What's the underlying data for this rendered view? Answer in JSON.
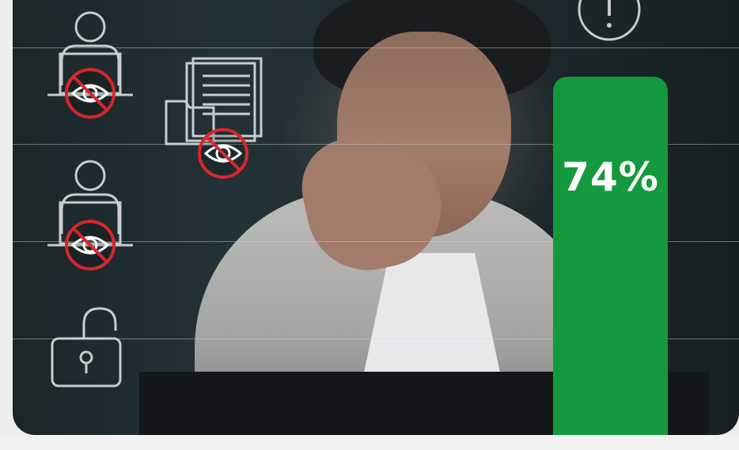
{
  "stat": {
    "value_label": "74%",
    "percent": 74
  },
  "colors": {
    "bar": "#149a3c",
    "forbidden": "#d8262b",
    "icon_stroke": "#c8ccce"
  },
  "icons": [
    "user-laptop-icon",
    "no-eye-icon",
    "folder-document-icon",
    "no-eye-icon",
    "user-laptop-icon",
    "no-eye-icon",
    "unlocked-padlock-icon",
    "alert-icon"
  ]
}
